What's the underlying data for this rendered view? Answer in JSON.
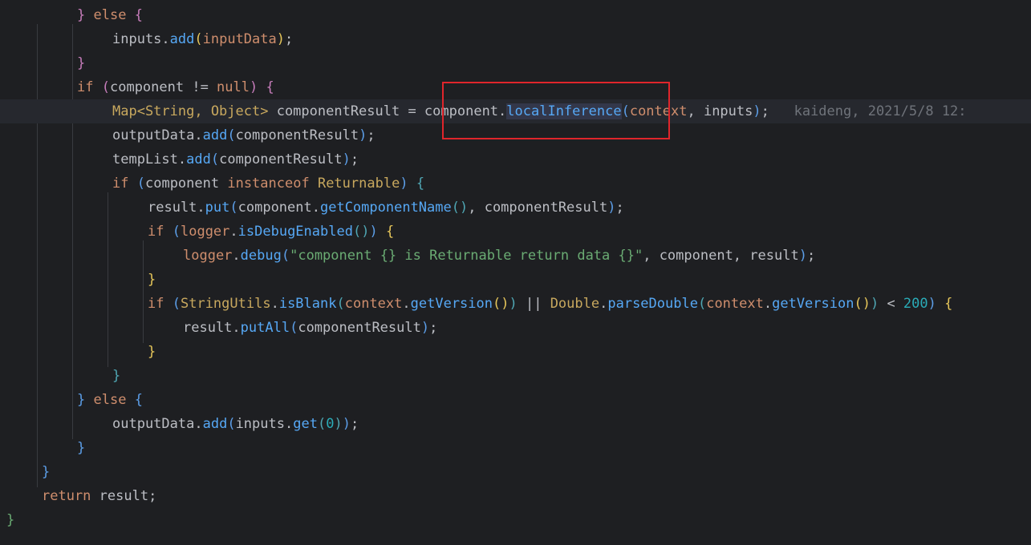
{
  "editor": {
    "lines": [
      {
        "indent": 96,
        "tokens": [
          {
            "t": "}",
            "c": "p2"
          },
          {
            "t": " "
          },
          {
            "t": "else",
            "c": "kw"
          },
          {
            "t": " "
          },
          {
            "t": "{",
            "c": "p2"
          }
        ]
      },
      {
        "indent": 140,
        "tokens": [
          {
            "t": "inputs."
          },
          {
            "t": "add",
            "c": "fn"
          },
          {
            "t": "(",
            "c": "p1"
          },
          {
            "t": "inputData",
            "c": "kw"
          },
          {
            "t": ")",
            "c": "p1"
          },
          {
            "t": ";"
          }
        ]
      },
      {
        "indent": 96,
        "tokens": [
          {
            "t": "}",
            "c": "p2"
          }
        ]
      },
      {
        "indent": 96,
        "tokens": [
          {
            "t": "if",
            "c": "kw"
          },
          {
            "t": " "
          },
          {
            "t": "(",
            "c": "p2"
          },
          {
            "t": "component != "
          },
          {
            "t": "null",
            "c": "kw"
          },
          {
            "t": ")",
            "c": "p2"
          },
          {
            "t": " "
          },
          {
            "t": "{",
            "c": "p2"
          }
        ]
      },
      {
        "indent": 140,
        "current": true,
        "tokens": [
          {
            "t": "Map<String, Object>",
            "c": "type"
          },
          {
            "t": " componentResult = component."
          },
          {
            "t": "localInference",
            "c": "fn hl"
          },
          {
            "t": "(",
            "c": "p3"
          },
          {
            "t": "context",
            "c": "kw"
          },
          {
            "t": ", inputs"
          },
          {
            "t": ")",
            "c": "p3"
          },
          {
            "t": ";"
          }
        ],
        "inlay": "kaideng, 2021/5/8 12:"
      },
      {
        "indent": 140,
        "tokens": [
          {
            "t": "outputData."
          },
          {
            "t": "add",
            "c": "fn"
          },
          {
            "t": "(",
            "c": "p3"
          },
          {
            "t": "componentResult"
          },
          {
            "t": ")",
            "c": "p3"
          },
          {
            "t": ";"
          }
        ]
      },
      {
        "indent": 140,
        "tokens": [
          {
            "t": "tempList."
          },
          {
            "t": "add",
            "c": "fn"
          },
          {
            "t": "(",
            "c": "p3"
          },
          {
            "t": "componentResult"
          },
          {
            "t": ")",
            "c": "p3"
          },
          {
            "t": ";"
          }
        ]
      },
      {
        "indent": 140,
        "tokens": [
          {
            "t": "if",
            "c": "kw"
          },
          {
            "t": " "
          },
          {
            "t": "(",
            "c": "p3"
          },
          {
            "t": "component "
          },
          {
            "t": "instanceof",
            "c": "kw"
          },
          {
            "t": " "
          },
          {
            "t": "Returnable",
            "c": "type"
          },
          {
            "t": ")",
            "c": "p3"
          },
          {
            "t": " "
          },
          {
            "t": "{",
            "c": "p4"
          }
        ]
      },
      {
        "indent": 184,
        "tokens": [
          {
            "t": "result."
          },
          {
            "t": "put",
            "c": "fn"
          },
          {
            "t": "(",
            "c": "p3"
          },
          {
            "t": "component."
          },
          {
            "t": "getComponentName",
            "c": "fn"
          },
          {
            "t": "()",
            "c": "p4"
          },
          {
            "t": ", componentResult"
          },
          {
            "t": ")",
            "c": "p3"
          },
          {
            "t": ";"
          }
        ]
      },
      {
        "indent": 184,
        "tokens": [
          {
            "t": "if",
            "c": "kw"
          },
          {
            "t": " "
          },
          {
            "t": "(",
            "c": "p3"
          },
          {
            "t": "logger",
            "c": "kw"
          },
          {
            "t": "."
          },
          {
            "t": "isDebugEnabled",
            "c": "fn"
          },
          {
            "t": "()",
            "c": "p4"
          },
          {
            "t": ")",
            "c": "p3"
          },
          {
            "t": " "
          },
          {
            "t": "{",
            "c": "p1"
          }
        ]
      },
      {
        "indent": 228,
        "tokens": [
          {
            "t": "logger",
            "c": "kw"
          },
          {
            "t": "."
          },
          {
            "t": "debug",
            "c": "fn"
          },
          {
            "t": "(",
            "c": "p3"
          },
          {
            "t": "\"component {} is Returnable return data {}\"",
            "c": "str"
          },
          {
            "t": ", component, result"
          },
          {
            "t": ")",
            "c": "p3"
          },
          {
            "t": ";"
          }
        ]
      },
      {
        "indent": 184,
        "tokens": [
          {
            "t": "}",
            "c": "p1"
          }
        ]
      },
      {
        "indent": 184,
        "tokens": [
          {
            "t": "if",
            "c": "kw"
          },
          {
            "t": " "
          },
          {
            "t": "(",
            "c": "p3"
          },
          {
            "t": "StringUtils",
            "c": "type"
          },
          {
            "t": "."
          },
          {
            "t": "isBlank",
            "c": "fn"
          },
          {
            "t": "(",
            "c": "p4"
          },
          {
            "t": "context",
            "c": "kw"
          },
          {
            "t": "."
          },
          {
            "t": "getVersion",
            "c": "fn"
          },
          {
            "t": "()",
            "c": "p1"
          },
          {
            "t": ")",
            "c": "p4"
          },
          {
            "t": " || "
          },
          {
            "t": "Double",
            "c": "type"
          },
          {
            "t": "."
          },
          {
            "t": "parseDouble",
            "c": "fn"
          },
          {
            "t": "(",
            "c": "p4"
          },
          {
            "t": "context",
            "c": "kw"
          },
          {
            "t": "."
          },
          {
            "t": "getVersion",
            "c": "fn"
          },
          {
            "t": "()",
            "c": "p1"
          },
          {
            "t": ")",
            "c": "p4"
          },
          {
            "t": " < "
          },
          {
            "t": "200",
            "c": "num"
          },
          {
            "t": ")",
            "c": "p3"
          },
          {
            "t": " "
          },
          {
            "t": "{",
            "c": "p1"
          }
        ]
      },
      {
        "indent": 228,
        "tokens": [
          {
            "t": "result."
          },
          {
            "t": "putAll",
            "c": "fn"
          },
          {
            "t": "(",
            "c": "p3"
          },
          {
            "t": "componentResult"
          },
          {
            "t": ")",
            "c": "p3"
          },
          {
            "t": ";"
          }
        ]
      },
      {
        "indent": 184,
        "tokens": [
          {
            "t": "}",
            "c": "p1"
          }
        ]
      },
      {
        "indent": 140,
        "tokens": [
          {
            "t": "}",
            "c": "p4"
          }
        ]
      },
      {
        "indent": 96,
        "tokens": [
          {
            "t": "}",
            "c": "p3"
          },
          {
            "t": " "
          },
          {
            "t": "else",
            "c": "kw"
          },
          {
            "t": " "
          },
          {
            "t": "{",
            "c": "p3"
          }
        ]
      },
      {
        "indent": 140,
        "tokens": [
          {
            "t": "outputData."
          },
          {
            "t": "add",
            "c": "fn"
          },
          {
            "t": "(",
            "c": "p3"
          },
          {
            "t": "inputs."
          },
          {
            "t": "get",
            "c": "fn"
          },
          {
            "t": "(",
            "c": "p4"
          },
          {
            "t": "0",
            "c": "num"
          },
          {
            "t": ")",
            "c": "p4"
          },
          {
            "t": ")",
            "c": "p3"
          },
          {
            "t": ";"
          }
        ]
      },
      {
        "indent": 96,
        "tokens": [
          {
            "t": "}",
            "c": "p3"
          }
        ]
      },
      {
        "indent": 52,
        "tokens": [
          {
            "t": "}",
            "c": "p3"
          }
        ]
      },
      {
        "indent": 52,
        "tokens": [
          {
            "t": "return",
            "c": "kw"
          },
          {
            "t": " result;"
          }
        ]
      },
      {
        "indent": 8,
        "tokens": [
          {
            "t": "}",
            "c": "str"
          }
        ]
      }
    ]
  }
}
